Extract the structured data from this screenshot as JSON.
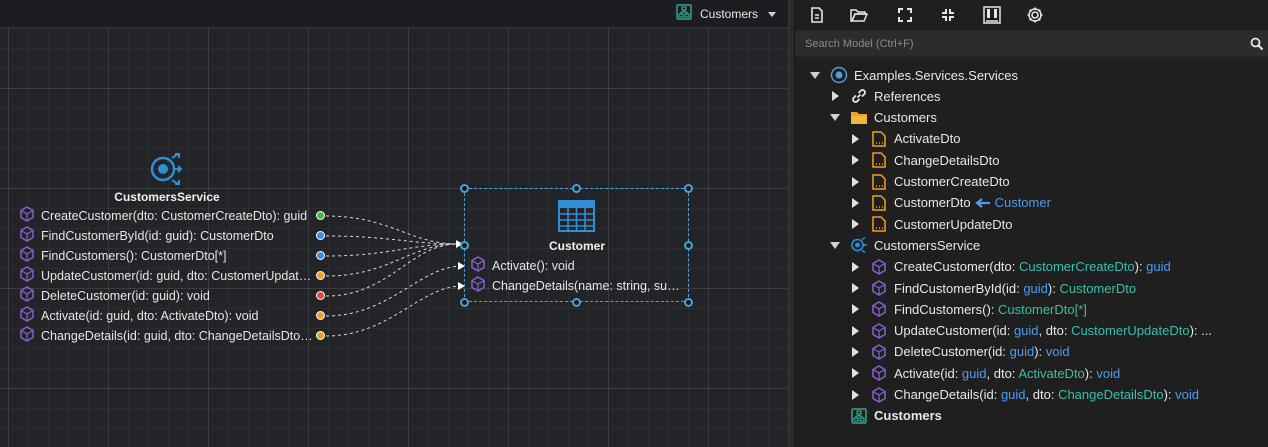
{
  "canvas": {
    "diagram_tab": {
      "label": "Customers",
      "icon": "diagram-icon"
    },
    "service_node": {
      "title": "CustomersService",
      "icon": "service-icon",
      "operations": [
        {
          "label": "CreateCustomer(dto: CustomerCreateDto): guid",
          "port_color": "#3fbf3f"
        },
        {
          "label": "FindCustomerById(id: guid): CustomerDto",
          "port_color": "#3a8ee6"
        },
        {
          "label": "FindCustomers(): CustomerDto[*]",
          "port_color": "#3a8ee6"
        },
        {
          "label": "UpdateCustomer(id: guid, dto: CustomerUpdateDto): void",
          "port_color": "#f0a020"
        },
        {
          "label": "DeleteCustomer(id: guid): void",
          "port_color": "#e04a3a"
        },
        {
          "label": "Activate(id: guid, dto: ActivateDto): void",
          "port_color": "#f0a020"
        },
        {
          "label": "ChangeDetails(id: guid, dto: ChangeDetailsDto): void",
          "port_color": "#f0a020"
        }
      ]
    },
    "entity_node": {
      "title": "Customer",
      "icon": "class-table-icon",
      "operations": [
        {
          "label": "Activate(): void"
        },
        {
          "label": "ChangeDetails(name: string, surname: string): void"
        }
      ]
    }
  },
  "toolbar": {
    "buttons": [
      {
        "name": "new-file-icon"
      },
      {
        "name": "open-folder-icon"
      },
      {
        "name": "expand-icon"
      },
      {
        "name": "collapse-icon"
      },
      {
        "name": "diagram-layout-icon"
      },
      {
        "name": "gear-icon"
      }
    ]
  },
  "search": {
    "placeholder": "Search Model (Ctrl+F)",
    "value": ""
  },
  "tree": {
    "root": {
      "label": "Examples.Services.Services"
    },
    "references": {
      "label": "References"
    },
    "customers_folder": {
      "label": "Customers"
    },
    "dtos": [
      {
        "label": "ActivateDto"
      },
      {
        "label": "ChangeDetailsDto"
      },
      {
        "label": "CustomerCreateDto"
      },
      {
        "label": "CustomerDto",
        "mapping": "Customer"
      },
      {
        "label": "CustomerUpdateDto"
      }
    ],
    "service": {
      "label": "CustomersService"
    },
    "operations": [
      {
        "parts": [
          [
            "CreateCustomer(dto: ",
            "w"
          ],
          [
            "CustomerCreateDto",
            "t"
          ],
          [
            "): ",
            "w"
          ],
          [
            "guid",
            "b"
          ]
        ]
      },
      {
        "parts": [
          [
            "FindCustomerById(id: ",
            "w"
          ],
          [
            "guid",
            "b"
          ],
          [
            "): ",
            "w"
          ],
          [
            "CustomerDto",
            "t"
          ]
        ]
      },
      {
        "parts": [
          [
            "FindCustomers(): ",
            "w"
          ],
          [
            "CustomerDto[*]",
            "t"
          ]
        ]
      },
      {
        "parts": [
          [
            "UpdateCustomer(id: ",
            "w"
          ],
          [
            "guid",
            "b"
          ],
          [
            ", dto: ",
            "w"
          ],
          [
            "CustomerUpdateDto",
            "t"
          ],
          [
            "): ...",
            "w"
          ]
        ]
      },
      {
        "parts": [
          [
            "DeleteCustomer(id: ",
            "w"
          ],
          [
            "guid",
            "b"
          ],
          [
            "): ",
            "w"
          ],
          [
            "void",
            "b"
          ]
        ]
      },
      {
        "parts": [
          [
            "Activate(id: ",
            "w"
          ],
          [
            "guid",
            "b"
          ],
          [
            ", dto: ",
            "w"
          ],
          [
            "ActivateDto",
            "t"
          ],
          [
            "): ",
            "w"
          ],
          [
            "void",
            "b"
          ]
        ]
      },
      {
        "parts": [
          [
            "ChangeDetails(id: ",
            "w"
          ],
          [
            "guid",
            "b"
          ],
          [
            ", dto: ",
            "w"
          ],
          [
            "ChangeDetailsDto",
            "t"
          ],
          [
            "): ",
            "w"
          ],
          [
            "void",
            "b"
          ]
        ]
      }
    ],
    "diagram": {
      "label": "Customers"
    }
  },
  "colors": {
    "accent": "#4ea3d6",
    "type_teal": "#39c0a8",
    "type_blue": "#4a9df0",
    "dto_orange": "#f0a020",
    "operation_purple": "#8a5fd0"
  }
}
